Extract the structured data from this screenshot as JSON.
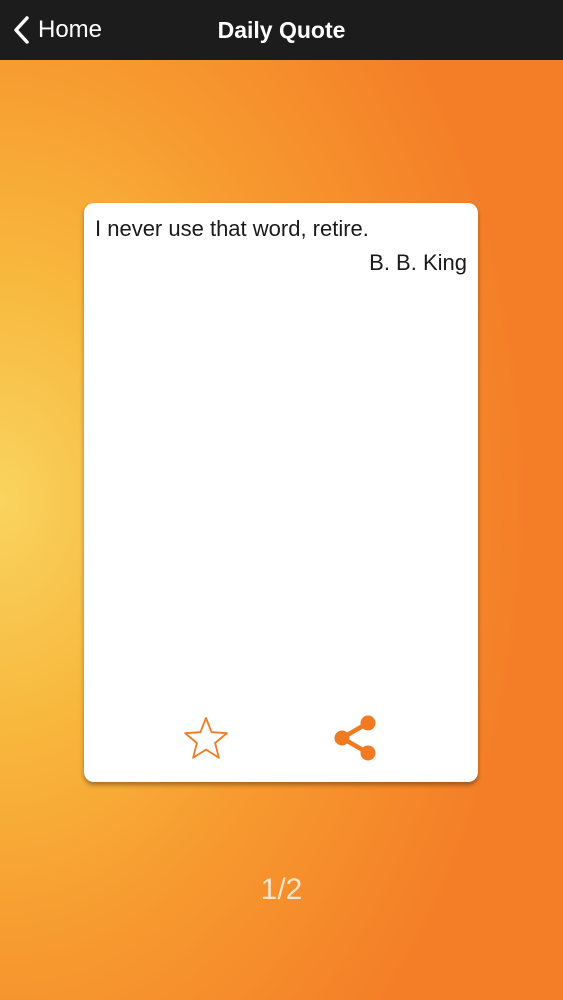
{
  "navbar": {
    "back_label": "Home",
    "title": "Daily Quote",
    "back_icon": "chevron-left-icon"
  },
  "quote": {
    "text": "I never use that word, retire.",
    "author": "B. B. King"
  },
  "actions": {
    "favorite_icon": "star-outline-icon",
    "share_icon": "share-icon"
  },
  "pagination": {
    "indicator": "1/2"
  },
  "colors": {
    "navbar_bg": "#1c1c1c",
    "accent": "#f07a22",
    "background_light": "#f9d45f",
    "background_dark": "#f47d27",
    "card_bg": "#ffffff"
  }
}
